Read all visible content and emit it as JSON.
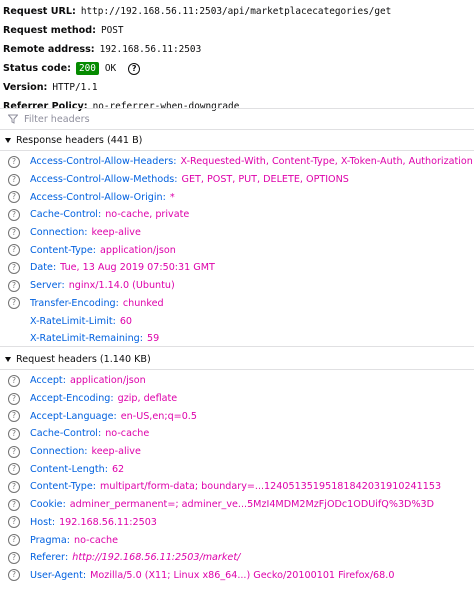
{
  "summary": {
    "request_url_label": "Request URL:",
    "request_url": "http://192.168.56.11:2503/api/marketplacecategories/get",
    "request_method_label": "Request method:",
    "request_method": "POST",
    "remote_address_label": "Remote address:",
    "remote_address": "192.168.56.11:2503",
    "status_code_label": "Status code:",
    "status_code": "200",
    "status_text": "OK",
    "version_label": "Version:",
    "version": "HTTP/1.1",
    "referrer_policy_label": "Referrer Policy:",
    "referrer_policy": "no-referrer-when-downgrade"
  },
  "filter": {
    "placeholder": "Filter headers"
  },
  "response_headers": {
    "title": "Response headers (441 B)",
    "items": [
      {
        "name": "Access-Control-Allow-Headers",
        "value": "X-Requested-With, Content-Type, X-Token-Auth, Authorization"
      },
      {
        "name": "Access-Control-Allow-Methods",
        "value": "GET, POST, PUT, DELETE, OPTIONS"
      },
      {
        "name": "Access-Control-Allow-Origin",
        "value": "*"
      },
      {
        "name": "Cache-Control",
        "value": "no-cache, private"
      },
      {
        "name": "Connection",
        "value": "keep-alive"
      },
      {
        "name": "Content-Type",
        "value": "application/json"
      },
      {
        "name": "Date",
        "value": "Tue, 13 Aug 2019 07:50:31 GMT"
      },
      {
        "name": "Server",
        "value": "nginx/1.14.0 (Ubuntu)"
      },
      {
        "name": "Transfer-Encoding",
        "value": "chunked"
      },
      {
        "name": "X-RateLimit-Limit",
        "value": "60"
      },
      {
        "name": "X-RateLimit-Remaining",
        "value": "59"
      }
    ]
  },
  "request_headers": {
    "title": "Request headers (1.140 KB)",
    "items": [
      {
        "name": "Accept",
        "value": "application/json"
      },
      {
        "name": "Accept-Encoding",
        "value": "gzip, deflate"
      },
      {
        "name": "Accept-Language",
        "value": "en-US,en;q=0.5"
      },
      {
        "name": "Cache-Control",
        "value": "no-cache"
      },
      {
        "name": "Connection",
        "value": "keep-alive"
      },
      {
        "name": "Content-Length",
        "value": "62"
      },
      {
        "name": "Content-Type",
        "value": "multipart/form-data; boundary=...124051351951818420319102411​53"
      },
      {
        "name": "Cookie",
        "value": "adminer_permanent=; adminer_ve...5MzI4MDM2MzFjODc1ODUifQ%3D%3D"
      },
      {
        "name": "Host",
        "value": "192.168.56.11:2503"
      },
      {
        "name": "Pragma",
        "value": "no-cache"
      },
      {
        "name": "Referer",
        "value": "http://192.168.56.11:2503/market/"
      },
      {
        "name": "User-Agent",
        "value": "Mozilla/5.0 (X11; Linux x86_64...) Gecko/20100101 Firefox/68.0"
      }
    ]
  },
  "icons": {
    "help": "question-mark-circle-icon",
    "filter": "funnel-icon",
    "twisty": "triangle-down-icon"
  },
  "colors": {
    "header_name": "#0060df",
    "header_value": "#dd00a9",
    "status_ok": "#058b00"
  }
}
